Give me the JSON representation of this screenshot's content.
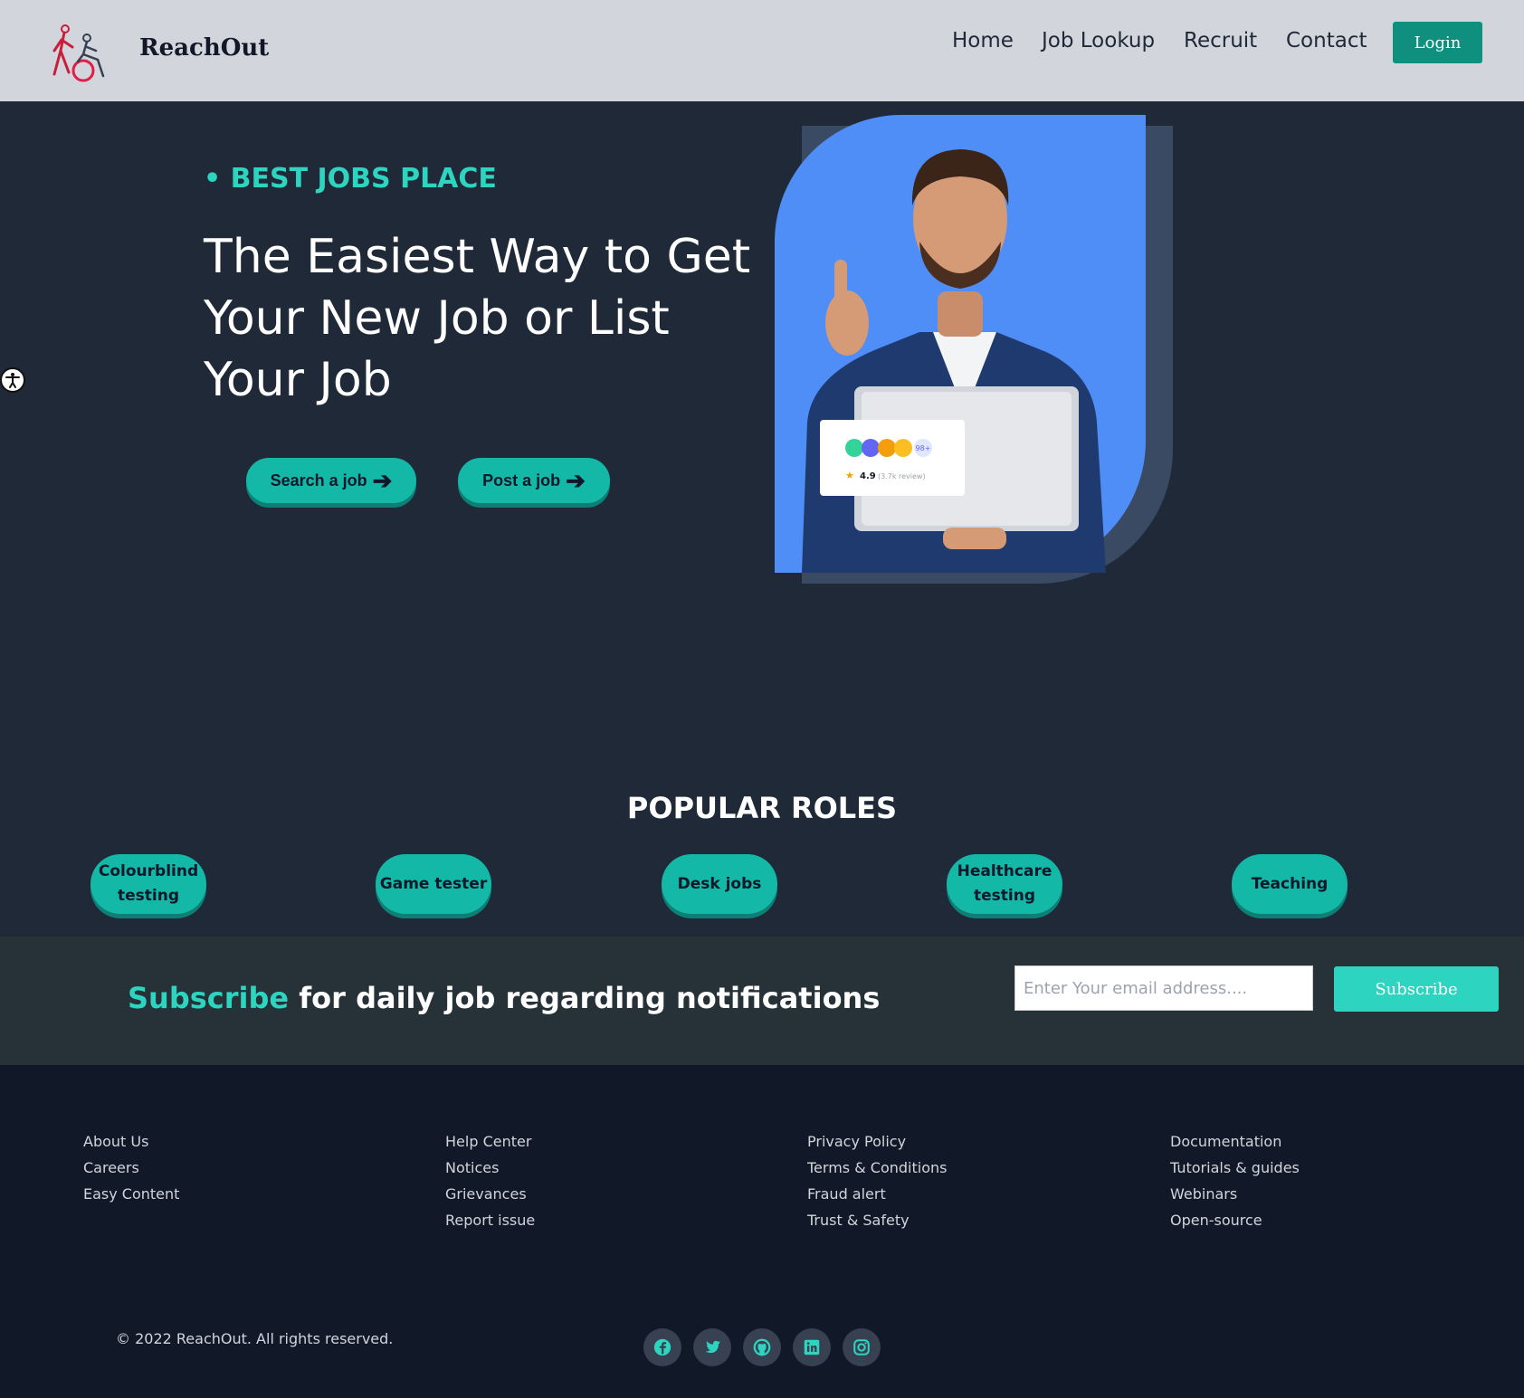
{
  "header": {
    "brand": "ReachOut",
    "nav": [
      "Home",
      "Job Lookup",
      "Recruit",
      "Contact"
    ],
    "login_label": "Login"
  },
  "hero": {
    "eyebrow": "• BEST JOBS PLACE",
    "title_lines": [
      "The Easiest Way to Get",
      "Your New Job or List",
      "Your Job"
    ],
    "search_label": "Search a job",
    "post_label": "Post a job",
    "card": {
      "rating": "4.9",
      "reviews": "(3.7k review)",
      "badge": "98+"
    }
  },
  "roles": {
    "title": "POPULAR ROLES",
    "items": [
      [
        "Colourblind",
        "testing"
      ],
      [
        "Game tester"
      ],
      [
        "Desk jobs"
      ],
      [
        "Healthcare",
        "testing"
      ],
      [
        "Teaching"
      ]
    ]
  },
  "subscribe": {
    "accent": "Subscribe",
    "text": " for daily job regarding notifications",
    "placeholder": "Enter Your email address....",
    "button_label": "Subscribe"
  },
  "footer": {
    "columns": [
      [
        "About Us",
        "Careers",
        "Easy Content"
      ],
      [
        "Help Center",
        "Notices",
        "Grievances",
        "Report issue"
      ],
      [
        "Privacy Policy",
        "Terms & Conditions",
        "Fraud alert",
        "Trust & Safety"
      ],
      [
        "Documentation",
        "Tutorials & guides",
        "Webinars",
        "Open-source"
      ]
    ],
    "copyright": "© 2022 ReachOut. All rights reserved.",
    "social_icons": [
      "facebook-icon",
      "twitter-icon",
      "github-icon",
      "linkedin-icon",
      "instagram-icon"
    ]
  },
  "colors": {
    "accent": "#2dd4bf",
    "button": "#14b8a6",
    "login": "#0f8f7e",
    "page_bg": "#1f2937",
    "footer_bg": "#111827",
    "hero_blue": "#4f8df7"
  }
}
